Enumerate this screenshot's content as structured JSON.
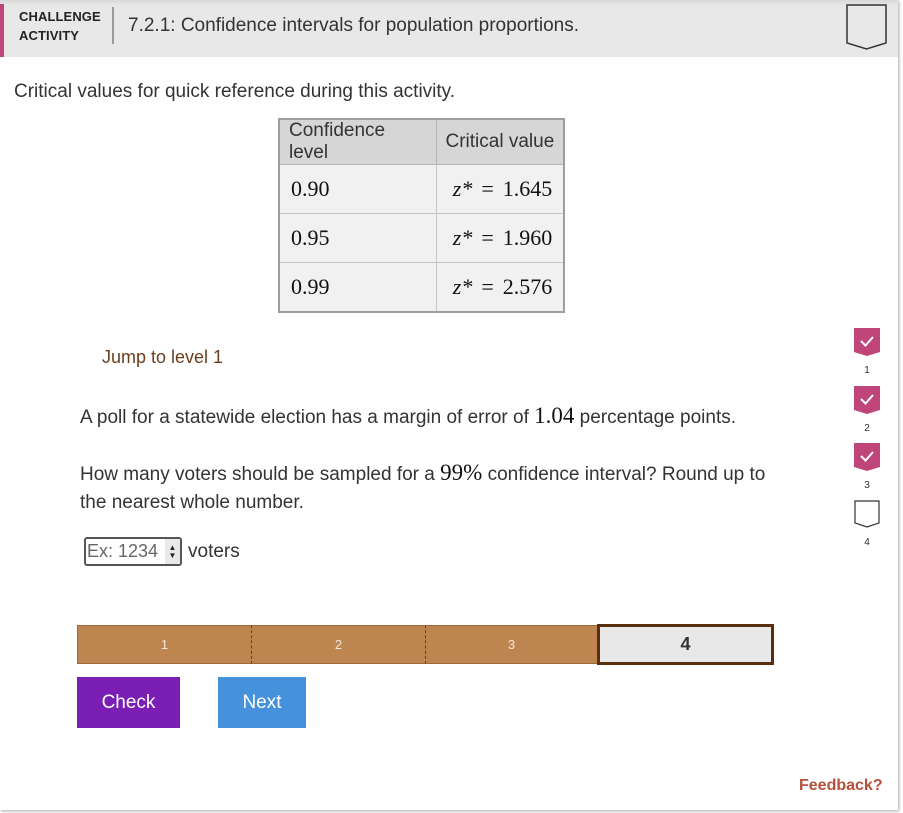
{
  "header": {
    "label_line1": "CHALLENGE",
    "label_line2": "ACTIVITY",
    "title": "7.2.1: Confidence intervals for population proportions.",
    "completion_badge_icon": "shield-outline-icon",
    "accent_color": "#c0457a"
  },
  "intro": "Critical values for quick reference during this activity.",
  "critical_table": {
    "headers": [
      "Confidence level",
      "Critical value"
    ],
    "rows": [
      {
        "level": "0.90",
        "var": "z*",
        "eq": "=",
        "value": "1.645"
      },
      {
        "level": "0.95",
        "var": "z*",
        "eq": "=",
        "value": "1.960"
      },
      {
        "level": "0.99",
        "var": "z*",
        "eq": "=",
        "value": "2.576"
      }
    ]
  },
  "jump_link": "Jump to level 1",
  "question": {
    "p1_before": "A poll for a statewide election has a margin of error of ",
    "p1_value": "1.04",
    "p1_after": " percentage points.",
    "p2_before": "How many voters should be sampled for a ",
    "p2_value": "99%",
    "p2_after": " confidence interval? Round up to the nearest whole number."
  },
  "answer": {
    "value": "",
    "placeholder": "Ex: 1234",
    "units": "voters"
  },
  "levels": {
    "items": [
      "1",
      "2",
      "3",
      "4"
    ],
    "completed": [
      true,
      true,
      true,
      false
    ],
    "current": "4",
    "completed_color": "#bd8650",
    "current_border_color": "#5a2f10"
  },
  "buttons": {
    "check": "Check",
    "next": "Next",
    "check_color": "#7b1fb4",
    "next_color": "#4691db"
  },
  "tracker": {
    "items": [
      {
        "label": "1",
        "status": "completed",
        "icon": "checkmark-icon"
      },
      {
        "label": "2",
        "status": "completed",
        "icon": "checkmark-icon"
      },
      {
        "label": "3",
        "status": "completed",
        "icon": "checkmark-icon"
      },
      {
        "label": "4",
        "status": "incomplete",
        "icon": "shield-outline-icon"
      }
    ],
    "completed_color": "#c0457a"
  },
  "feedback": "Feedback?"
}
